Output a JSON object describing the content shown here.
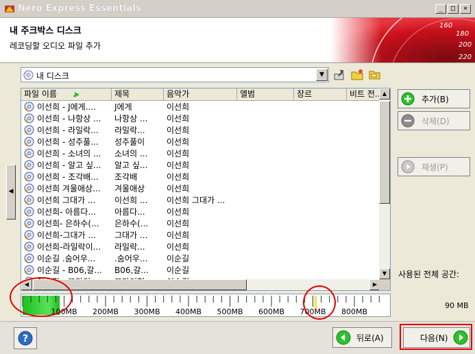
{
  "window": {
    "title": "Nero Express Essentials",
    "controls": [
      "_",
      "□",
      "×"
    ]
  },
  "header": {
    "title": "내 주크박스 디스크",
    "subtitle": "레코딩할 오디오 파일 추가",
    "gauge_numbers": [
      "160",
      "180",
      "200",
      "220"
    ]
  },
  "disc": {
    "selected": "내 디스크"
  },
  "list": {
    "columns": [
      "파일 이름",
      "제목",
      "음악가",
      "앨범",
      "장르",
      "비트 전..."
    ],
    "rows": [
      [
        "이선희 - J에게....",
        "J에게",
        "이선희"
      ],
      [
        "이선희 - 나항상 ...",
        "나항상 ...",
        "이선희"
      ],
      [
        "이선희 - 라일락...",
        "라일락...",
        "이선희"
      ],
      [
        "이선희 - 성주풀...",
        "성주풀이",
        "이선희"
      ],
      [
        "이선희 - 소녀의 ...",
        "소녀의 ...",
        "이선희"
      ],
      [
        "이선희 - 알고 싶...",
        "알고 싶...",
        "이선희"
      ],
      [
        "이선희 - 조각배...",
        "조각배",
        "이선희"
      ],
      [
        "이선희 겨울애상...",
        "겨울애상",
        "이선희"
      ],
      [
        "이선희 그대가 ...",
        "이선희 ...",
        "이선희 그대가 ..."
      ],
      [
        "이선희- 아름다...",
        "아름다...",
        "이선희"
      ],
      [
        "이선희- 은하수(...",
        "은하수(...",
        "이선희"
      ],
      [
        "이선희-그대가 ...",
        "그대가 ...",
        "이선희"
      ],
      [
        "이선희-라일락이...",
        "라일락...",
        "이선희"
      ],
      [
        "이순길 .숨어우...",
        ".숨어우...",
        "이순길"
      ],
      [
        "이순길 - B06,갈...",
        "B06,갈...",
        "이순길"
      ],
      [
        "이순길 - 꼬마인...",
        "꼬마인형",
        "이순길"
      ]
    ]
  },
  "actions": {
    "add": "추가(B)",
    "delete": "삭제(D)",
    "play": "재생(P)"
  },
  "usage": {
    "label": "사용된 전체 공간:",
    "value": "90 MB",
    "used_mb": 90,
    "scale_max_mb": 860,
    "tick_labels": [
      "100MB",
      "200MB",
      "300MB",
      "400MB",
      "500MB",
      "600MB",
      "700MB",
      "800MB"
    ]
  },
  "nav": {
    "back": "뒤로(A)",
    "next": "다음(N)"
  },
  "colors": {
    "accent_green": "#2fbf2f",
    "annotation_red": "#e00000"
  }
}
